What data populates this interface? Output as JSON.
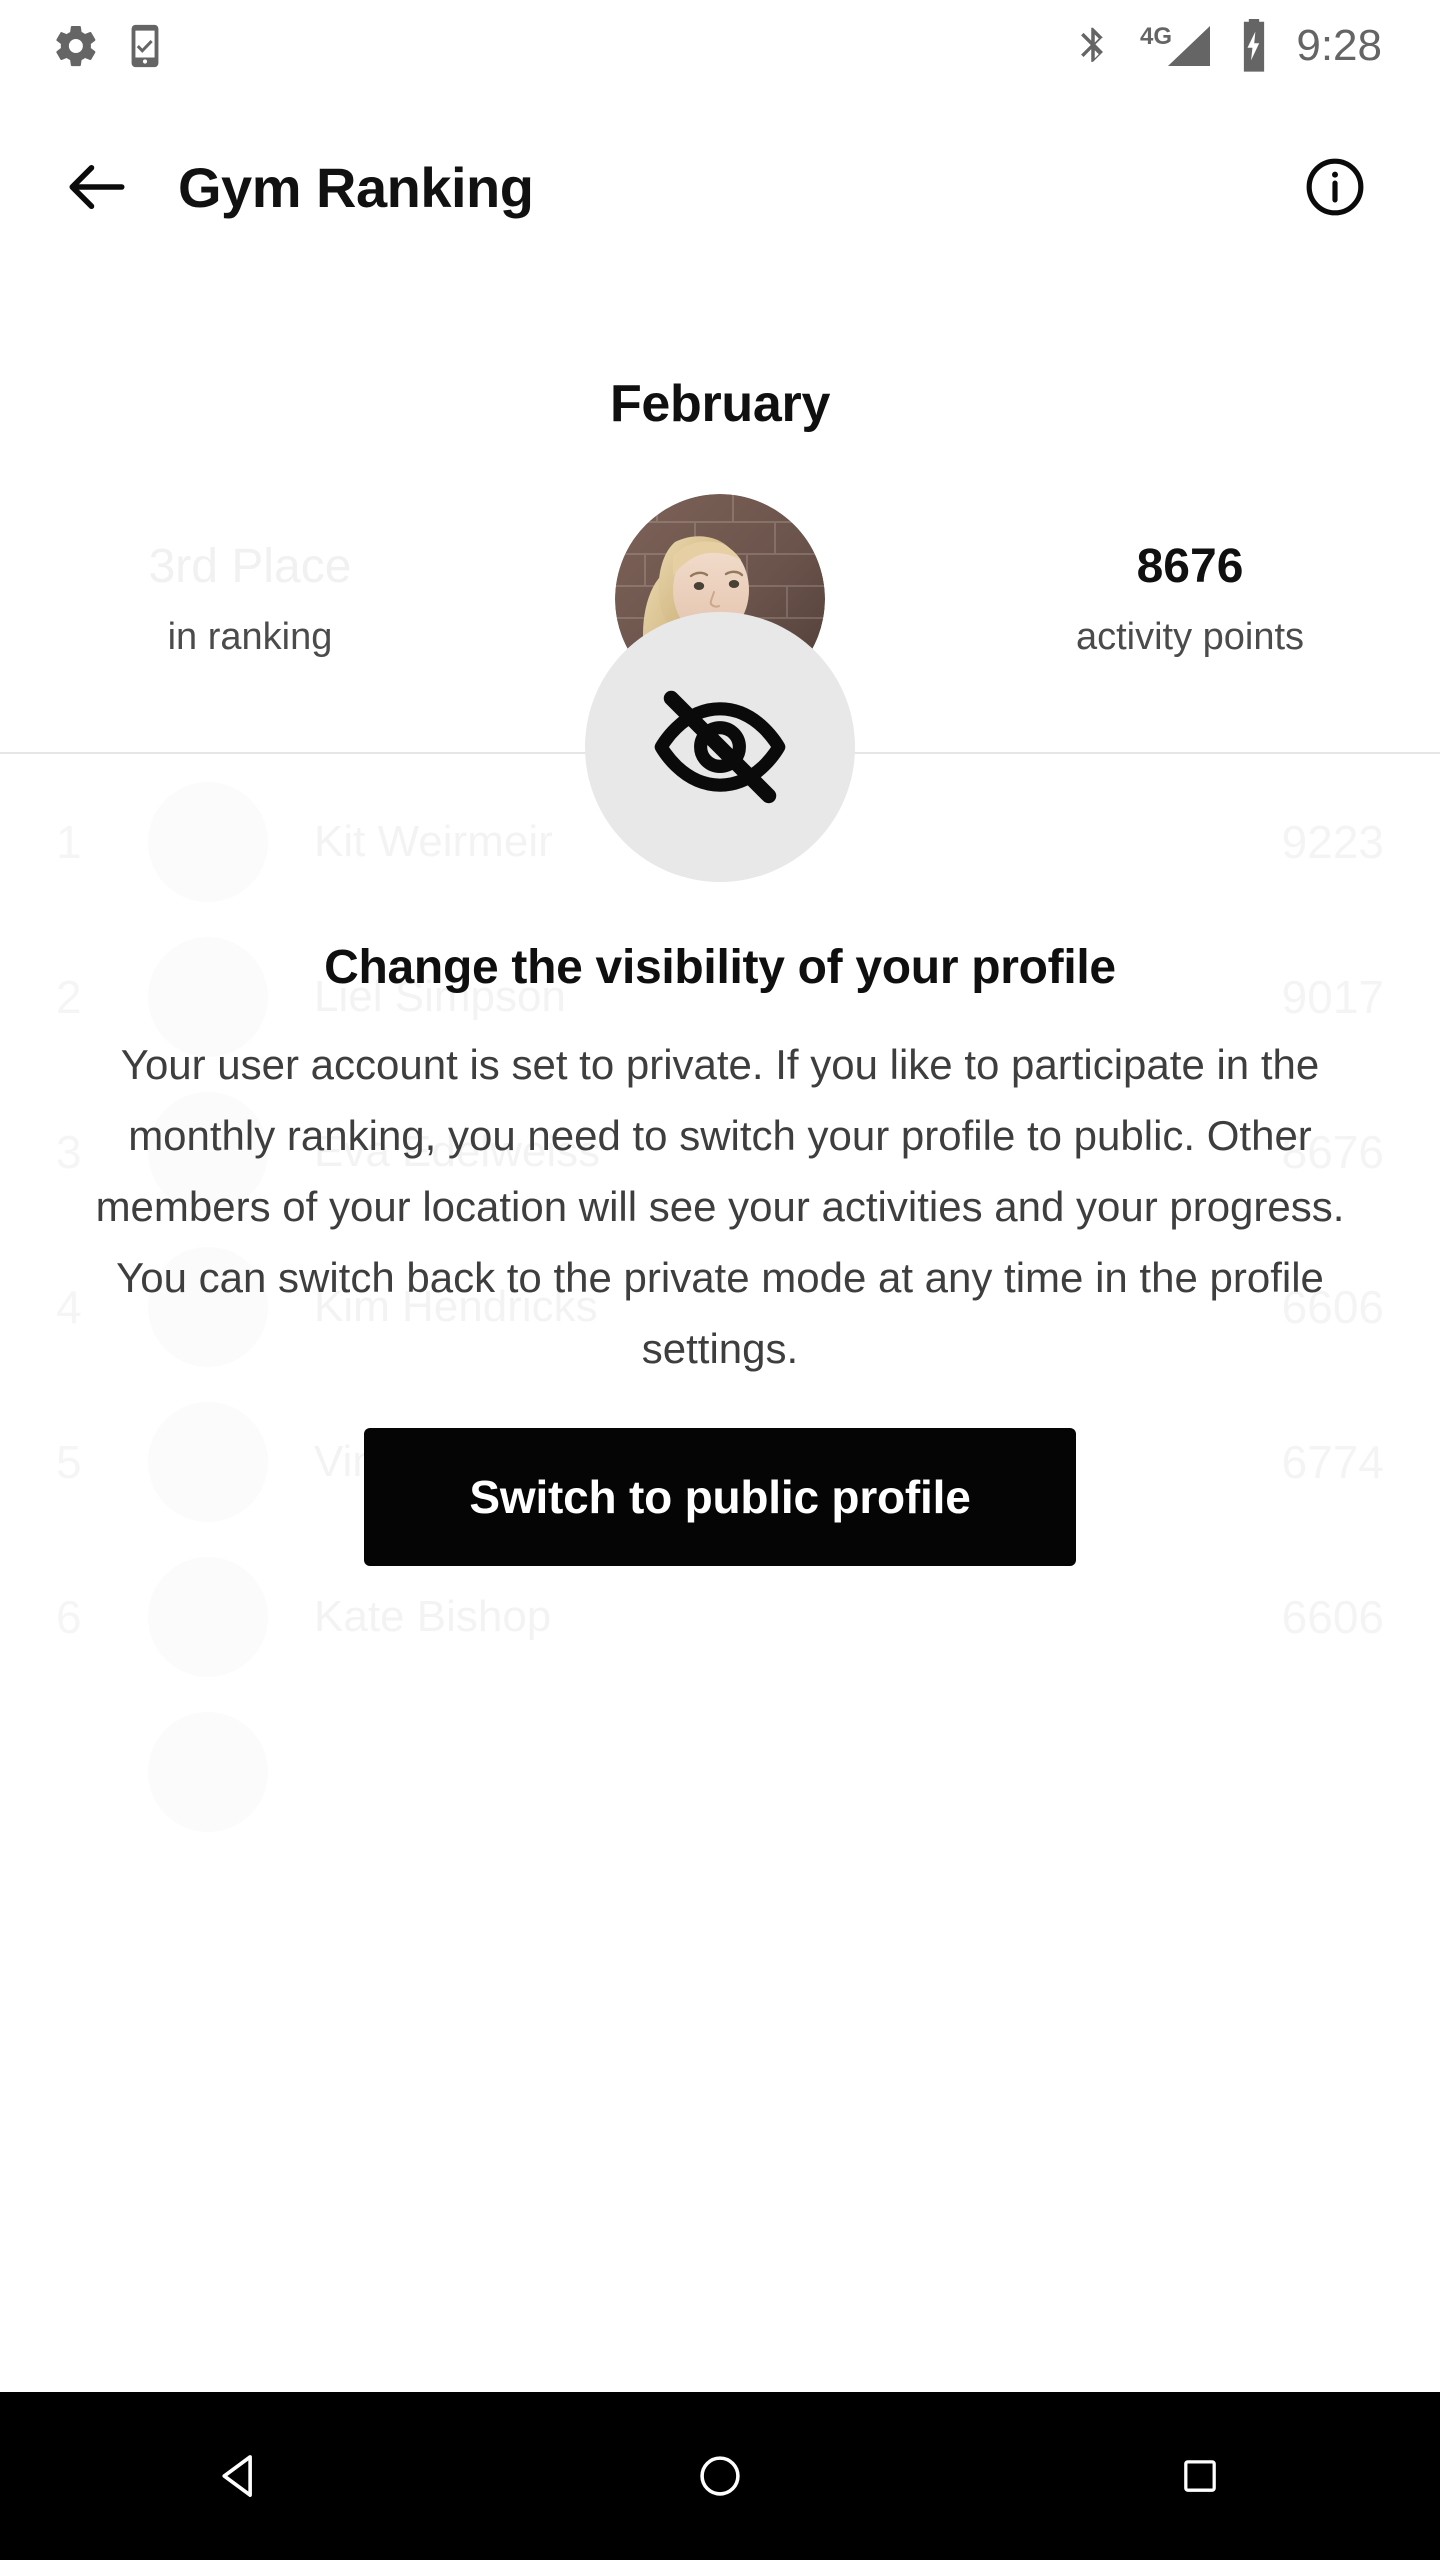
{
  "status_bar": {
    "time": "9:28",
    "icons": [
      "settings-gear-icon",
      "phone-check-icon",
      "bluetooth-icon",
      "signal-4g-icon",
      "battery-charging-icon"
    ],
    "network_label": "4G"
  },
  "app_bar": {
    "title": "Gym Ranking",
    "back_icon": "arrow-left-icon",
    "info_icon": "info-circle-icon"
  },
  "header": {
    "month": "February",
    "place": "3rd Place",
    "place_sub": "in ranking",
    "points": "8676",
    "points_sub": "activity points"
  },
  "ranking": {
    "rows": [
      {
        "rank": "1",
        "name": "Kit Weirmeir",
        "points": "9223"
      },
      {
        "rank": "2",
        "name": "Liel Simpson",
        "points": "9017"
      },
      {
        "rank": "3",
        "name": "Eva Edelweiss",
        "points": "8676"
      },
      {
        "rank": "4",
        "name": "Kim Hendricks",
        "points": "6606"
      },
      {
        "rank": "5",
        "name": "Vincent Aegerbaum",
        "points": "6774"
      },
      {
        "rank": "6",
        "name": "Kate Bishop",
        "points": "6606"
      }
    ]
  },
  "overlay": {
    "icon": "eye-slash-icon",
    "title": "Change the visibility of your profile",
    "body": "Your user account is set to private. If you like to participate in the monthly ranking, you need to switch your profile to public. Other members of your location will see your activities and your progress. You can switch back to the private mode at any time in the profile settings.",
    "button_label": "Switch to public profile"
  },
  "nav_bar": {
    "back": "nav-back-icon",
    "home": "nav-home-icon",
    "recents": "nav-recents-icon"
  },
  "colors": {
    "accent_dark": "#050505",
    "faded_text": "#f1f1f1",
    "circle_bg": "#e8e8e8",
    "status_icon": "#656565"
  }
}
